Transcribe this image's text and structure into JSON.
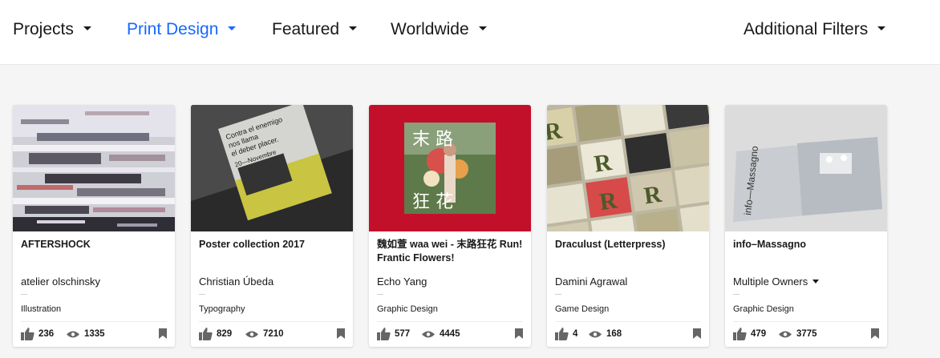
{
  "filters": [
    {
      "label": "Projects",
      "active": false
    },
    {
      "label": "Print Design",
      "active": true
    },
    {
      "label": "Featured",
      "active": false
    },
    {
      "label": "Worldwide",
      "active": false
    }
  ],
  "additional_filters": {
    "label": "Additional Filters"
  },
  "colors": {
    "accent": "#1769ff",
    "text": "#191919",
    "background": "#f5f5f5"
  },
  "cards": [
    {
      "title": "AFTERSHOCK",
      "owner": "atelier olschinsky",
      "field": "Illustration",
      "likes": "236",
      "views": "1335"
    },
    {
      "title": "Poster collection 2017",
      "owner": "Christian Úbeda",
      "field": "Typography",
      "likes": "829",
      "views": "7210"
    },
    {
      "title": "魏如萱 waa wei - 末路狂花 Run! Frantic Flowers!",
      "owner": "Echo Yang",
      "field": "Graphic Design",
      "likes": "577",
      "views": "4445"
    },
    {
      "title": "Draculust (Letterpress)",
      "owner": "Damini Agrawal",
      "field": "Game Design",
      "likes": "4",
      "views": "168"
    },
    {
      "title": "info–Massagno",
      "owner": "Multiple Owners",
      "field": "Graphic Design",
      "likes": "479",
      "views": "3775"
    }
  ],
  "thumb_text": {
    "poster_lines": [
      "Contra el enemigo",
      "nos llama",
      "el deber placer."
    ],
    "poster_date": "20—Novembre",
    "album_top": "末 路",
    "album_bottom": "狂 花",
    "draculust_word": "R",
    "massagno": "info—Massagno"
  }
}
